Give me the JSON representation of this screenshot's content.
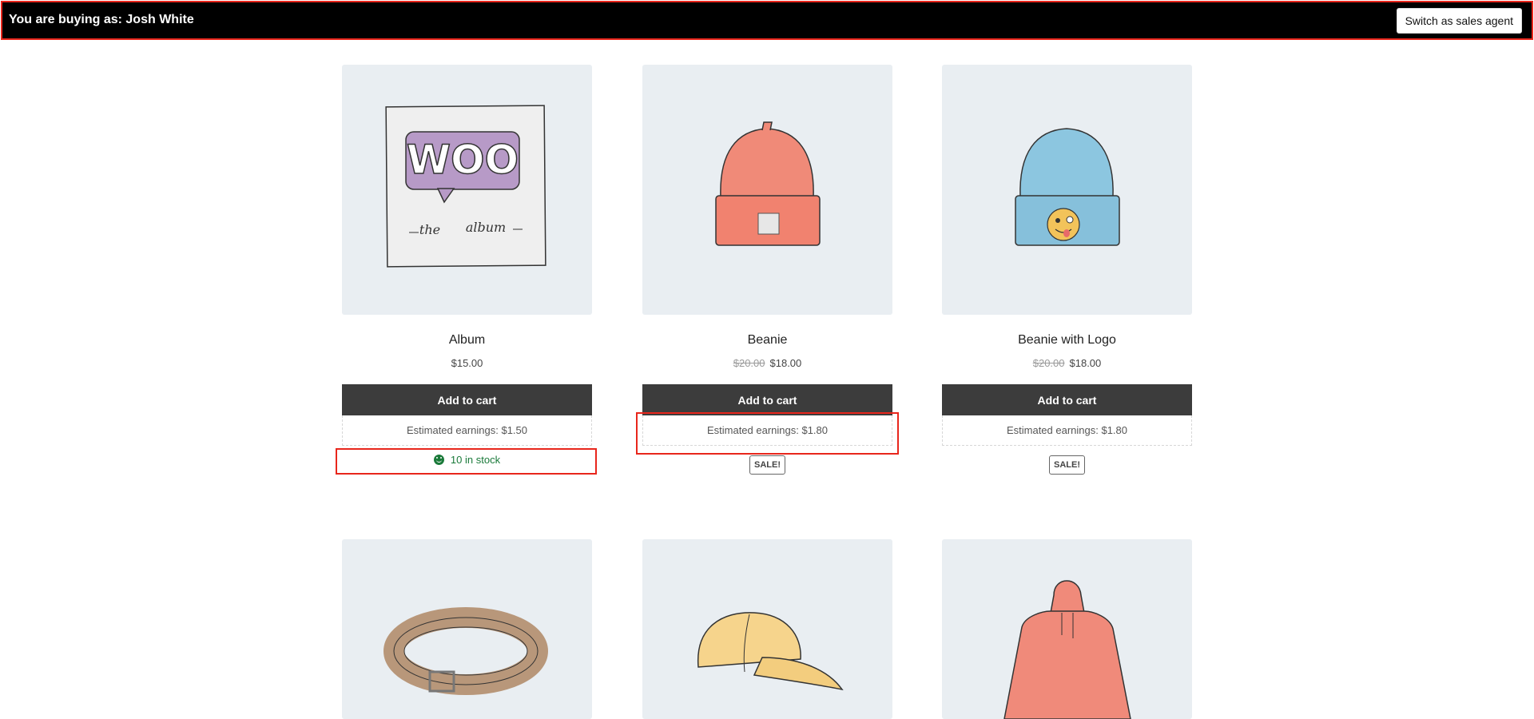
{
  "topbar": {
    "buying_as": "You are buying as: Josh White",
    "switch_label": "Switch as sales agent"
  },
  "products": [
    {
      "title": "Album",
      "price": "$15.00",
      "old_price": "",
      "add_to_cart": "Add to cart",
      "earnings": "Estimated earnings: $1.50",
      "stock": "10 in stock",
      "badge": "",
      "image_icon": "album-icon"
    },
    {
      "title": "Beanie",
      "price": "$18.00",
      "old_price": "$20.00",
      "add_to_cart": "Add to cart",
      "earnings": "Estimated earnings: $1.80",
      "stock": "",
      "badge": "SALE!",
      "image_icon": "beanie-icon"
    },
    {
      "title": "Beanie with Logo",
      "price": "$18.00",
      "old_price": "$20.00",
      "add_to_cart": "Add to cart",
      "earnings": "Estimated earnings: $1.80",
      "stock": "",
      "badge": "SALE!",
      "image_icon": "beanie-logo-icon"
    },
    {
      "image_icon": "belt-icon"
    },
    {
      "image_icon": "cap-icon"
    },
    {
      "image_icon": "hoodie-icon"
    }
  ],
  "colors": {
    "topbar_bg": "#000000",
    "highlight": "#e8261c",
    "button_bg": "#3c3c3c",
    "stock_green": "#1a7a3a",
    "image_bg": "#e9eef2"
  }
}
